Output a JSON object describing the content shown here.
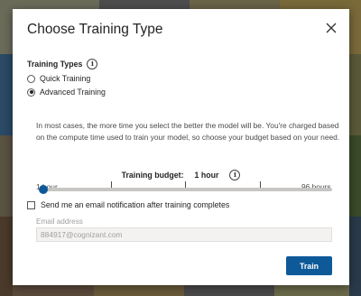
{
  "dialog": {
    "title": "Choose Training Type",
    "close_icon": "close-icon"
  },
  "training_types": {
    "label": "Training Types",
    "info_icon": "info-icon",
    "options": [
      {
        "label": "Quick Training",
        "selected": false
      },
      {
        "label": "Advanced Training",
        "selected": true
      }
    ],
    "description": "In most cases, the more time you select the better the model will be. You're charged based on the compute time used to train your model, so choose your budget based on your need."
  },
  "budget": {
    "label": "Training budget:",
    "value": "1 hour",
    "info_icon": "info-icon",
    "min_label": "1 hour",
    "max_label": "96 hours",
    "slider_fraction": 0
  },
  "notification": {
    "label": "Send me an email notification after training completes",
    "checked": false,
    "email_label": "Email address",
    "email_value": "884917@cognizant.com"
  },
  "actions": {
    "train_label": "Train"
  },
  "colors": {
    "accent": "#0e5a99",
    "backdrop": "#3b3b3b"
  }
}
